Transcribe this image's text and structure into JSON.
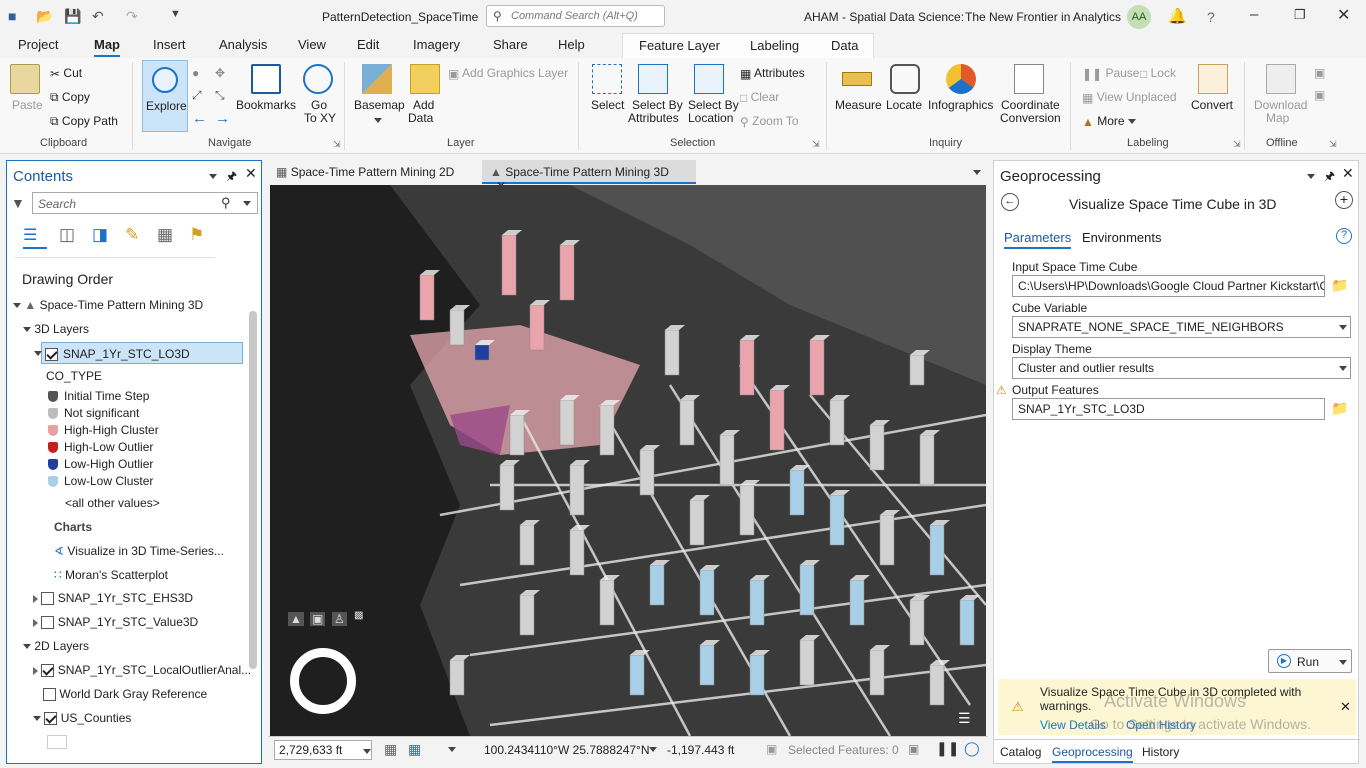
{
  "title": {
    "project": "PatternDetection_SpaceTime",
    "command_search_placeholder": "Command Search (Alt+Q)",
    "org": "AHAM - Spatial Data Science:",
    "subtitle": "The New Frontier in Analytics",
    "user_initials": "AA",
    "help": "?"
  },
  "ribbon": {
    "tabs": [
      "Project",
      "Map",
      "Insert",
      "Analysis",
      "View",
      "Edit",
      "Imagery",
      "Share",
      "Help"
    ],
    "context_tabs": [
      "Feature Layer",
      "Labeling",
      "Data"
    ],
    "active_tab": "Map",
    "clipboard": {
      "paste": "Paste",
      "cut": "Cut",
      "copy": "Copy",
      "copy_path": "Copy Path",
      "label": "Clipboard"
    },
    "navigate": {
      "explore": "Explore",
      "bookmarks": "Bookmarks",
      "goto": "Go",
      "goto2": "To XY",
      "label": "Navigate"
    },
    "layer": {
      "basemap": "Basemap",
      "add_data": "Add",
      "add_data2": "Data",
      "add_graphics": "Add Graphics Layer",
      "label": "Layer"
    },
    "selection": {
      "select": "Select",
      "by_attr": "Select By",
      "by_attr2": "Attributes",
      "by_loc": "Select By",
      "by_loc2": "Location",
      "attributes": "Attributes",
      "clear": "Clear",
      "zoom_to": "Zoom To",
      "label": "Selection"
    },
    "inquiry": {
      "measure": "Measure",
      "locate": "Locate",
      "infographics": "Infographics",
      "coord": "Coordinate",
      "coord2": "Conversion",
      "label": "Inquiry"
    },
    "labeling": {
      "pause": "Pause",
      "lock": "Lock",
      "view_unplaced": "View Unplaced",
      "more": "More",
      "convert": "Convert",
      "label": "Labeling"
    },
    "offline": {
      "download": "Download",
      "download2": "Map",
      "label": "Offline"
    }
  },
  "contents": {
    "title": "Contents",
    "search_placeholder": "Search",
    "drawing_order": "Drawing Order",
    "map_name": "Space-Time Pattern Mining 3D",
    "group_3d": "3D Layers",
    "layer_selected": "SNAP_1Yr_STC_LO3D",
    "field": "CO_TYPE",
    "legend": [
      {
        "label": "Initial Time Step",
        "color": "#555555"
      },
      {
        "label": "Not significant",
        "color": "#bdbdbd"
      },
      {
        "label": "High-High Cluster",
        "color": "#e8a0a0"
      },
      {
        "label": "High-Low Outlier",
        "color": "#c81e1e"
      },
      {
        "label": "Low-High Outlier",
        "color": "#1e3fa0"
      },
      {
        "label": "Low-Low Cluster",
        "color": "#a9cfe6"
      }
    ],
    "all_other": "<all other values>",
    "charts_label": "Charts",
    "charts": [
      "Visualize in 3D Time-Series...",
      "Moran's Scatterplot"
    ],
    "layer_ehs": "SNAP_1Yr_STC_EHS3D",
    "layer_value": "SNAP_1Yr_STC_Value3D",
    "group_2d": "2D Layers",
    "layer_local": "SNAP_1Yr_STC_LocalOutlierAnal...",
    "layer_basemap": "World Dark Gray Reference",
    "layer_counties": "US_Counties"
  },
  "mapview": {
    "tab1": "Space-Time Pattern Mining 2D",
    "tab2": "Space-Time Pattern Mining 3D",
    "scale": "2,729,633 ft",
    "coords": "100.2434110°W 25.7888247°N",
    "elev": "-1,197.443 ft",
    "selected": "Selected Features: 0"
  },
  "gp": {
    "title": "Geoprocessing",
    "tool": "Visualize Space Time Cube in 3D",
    "tab_params": "Parameters",
    "tab_env": "Environments",
    "input_label": "Input Space Time Cube",
    "input_value": "C:\\Users\\HP\\Downloads\\Google Cloud Partner Kickstart\\C",
    "var_label": "Cube Variable",
    "var_value": "SNAPRATE_NONE_SPACE_TIME_NEIGHBORS",
    "theme_label": "Display Theme",
    "theme_value": "Cluster and outlier results",
    "out_label": "Output Features",
    "out_value": "SNAP_1Yr_STC_LO3D",
    "run": "Run",
    "message": "Visualize Space Time Cube in 3D completed with warnings.",
    "view_details": "View Details",
    "open_history": "Open History",
    "watermark1": "Activate Windows",
    "watermark2": "Go to Settings to activate Windows.",
    "bottom_tabs": [
      "Catalog",
      "Geoprocessing",
      "History"
    ]
  },
  "colors": {
    "accent": "#1a73c8",
    "ribbon_active": "#cce4f7",
    "warning": "#fdf6d3"
  }
}
